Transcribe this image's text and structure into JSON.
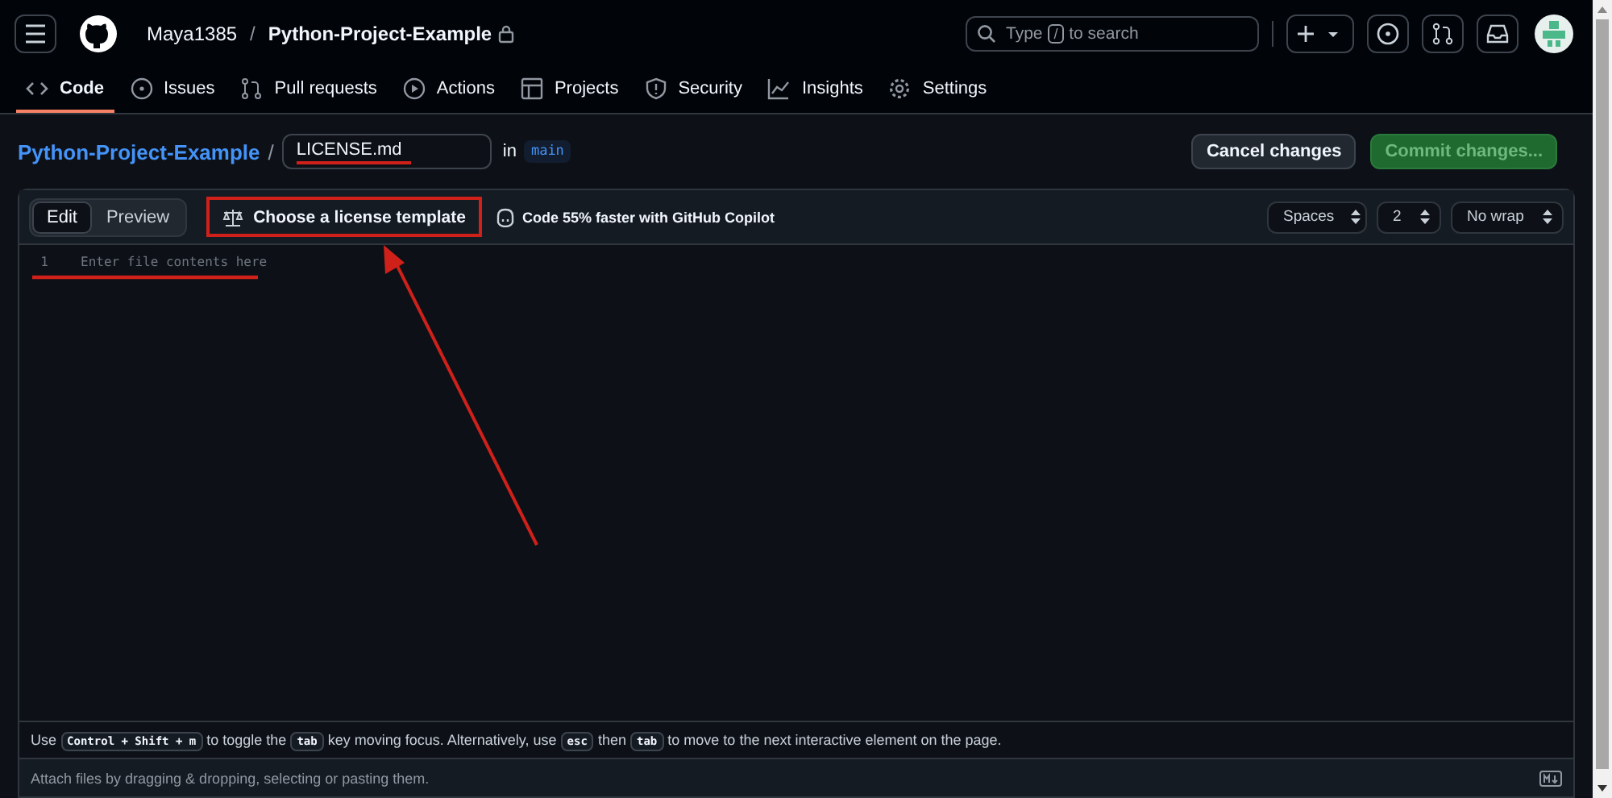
{
  "header": {
    "owner": "Maya1385",
    "separator": "/",
    "repo": "Python-Project-Example",
    "private": true,
    "search_placeholder_parts": [
      "Type",
      "/",
      "to search"
    ]
  },
  "tabs": [
    {
      "label": "Code",
      "kind": "code",
      "selected": true
    },
    {
      "label": "Issues",
      "kind": "issue",
      "selected": false
    },
    {
      "label": "Pull requests",
      "kind": "pr",
      "selected": false
    },
    {
      "label": "Actions",
      "kind": "play",
      "selected": false
    },
    {
      "label": "Projects",
      "kind": "table",
      "selected": false
    },
    {
      "label": "Security",
      "kind": "shield",
      "selected": false
    },
    {
      "label": "Insights",
      "kind": "graph",
      "selected": false
    },
    {
      "label": "Settings",
      "kind": "gear",
      "selected": false
    }
  ],
  "breadcrumb": {
    "repo": "Python-Project-Example",
    "separator": "/",
    "filename": "LICENSE.md",
    "in_label": "in",
    "branch": "main"
  },
  "buttons": {
    "cancel": "Cancel changes",
    "commit": "Commit changes...",
    "commit_disabled": true
  },
  "editor": {
    "modes": [
      {
        "label": "Edit",
        "selected": true
      },
      {
        "label": "Preview",
        "selected": false
      }
    ],
    "license_button": "Choose a license template",
    "copilot": "Code 55% faster with GitHub Copilot",
    "selects": [
      "Spaces",
      "2",
      "No wrap"
    ],
    "line_number": "1",
    "placeholder": "Enter file contents here"
  },
  "hint": [
    {
      "kind": "text",
      "text": "Use"
    },
    {
      "kind": "key",
      "text": "Control + Shift + m"
    },
    {
      "kind": "text",
      "text": "to toggle the"
    },
    {
      "kind": "key",
      "text": "tab"
    },
    {
      "kind": "text",
      "text": "key moving focus. Alternatively, use"
    },
    {
      "kind": "key",
      "text": "esc"
    },
    {
      "kind": "text",
      "text": "then"
    },
    {
      "kind": "key",
      "text": "tab"
    },
    {
      "kind": "text",
      "text": "to move to the next interactive element on the page."
    }
  ],
  "attach": "Attach files by dragging & dropping, selecting or pasting them."
}
